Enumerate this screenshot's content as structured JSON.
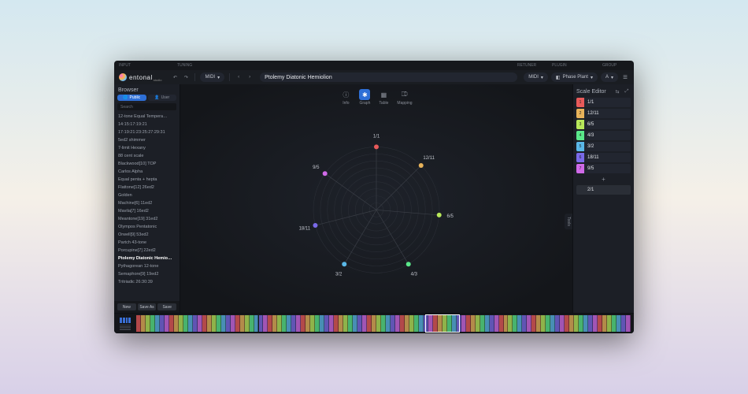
{
  "app": {
    "name": "entonal",
    "sub": "studio"
  },
  "topbar": {
    "input": "INPUT",
    "tuning": "TUNING",
    "retuner": "RETUNER",
    "plugin": "PLUGIN",
    "group": "GROUP"
  },
  "header": {
    "input_tag": "MIDI",
    "tuning_name": "Ptolemy Diatonic Hemiolion",
    "retuner_tag": "MIDI",
    "plugin_tag": "Phase Plant",
    "group_tag": "A"
  },
  "browser": {
    "title": "Browser",
    "tab_public": "Public",
    "tab_user": "User",
    "search_placeholder": "Search",
    "items": [
      "12-tone Equal Tempera…",
      "14:15:17:19:21",
      "17:19:21:23:25:27:29:31",
      "5ed2 shimmer",
      "7-limit Hexany",
      "88 cent scale",
      "Blackwood[10] TOP",
      "Carlos Alpha",
      "Equal penta + hepta",
      "Flattone[12] 26ed2",
      "Golden",
      "Machine[6] 11ed2",
      "Mavila[7] 16ed2",
      "Meantone[19] 31ed2",
      "Olympos Pentatonic",
      "Orwell[9] 53ed2",
      "Partch 43-tone",
      "Porcupine[7] 22ed2",
      "Ptolemy Diatonic Hemio…",
      "Pythagorean 12-tone",
      "Semaphore[9] 19ed2",
      "Tritriadic 26:30:39"
    ],
    "selected_index": 18,
    "btn_new": "New",
    "btn_saveas": "Save As",
    "btn_save": "Save"
  },
  "views": {
    "tabs": [
      {
        "id": "info",
        "label": "Info",
        "glyph": "ⓘ"
      },
      {
        "id": "graph",
        "label": "Graph",
        "glyph": "✱"
      },
      {
        "id": "table",
        "label": "Table",
        "glyph": "▦"
      },
      {
        "id": "mapping",
        "label": "Mapping",
        "glyph": "⎄"
      }
    ],
    "active": 1,
    "tools_label": "Tools"
  },
  "scale_notes": {
    "title": "Scale Editor",
    "period": "2/1",
    "items": [
      {
        "idx": "1",
        "ratio": "1/1",
        "color": "#e85a5a"
      },
      {
        "idx": "2",
        "ratio": "12/11",
        "color": "#e8b35a"
      },
      {
        "idx": "3",
        "ratio": "6/5",
        "color": "#b8e85a"
      },
      {
        "idx": "4",
        "ratio": "4/3",
        "color": "#5ae88a"
      },
      {
        "idx": "5",
        "ratio": "3/2",
        "color": "#5ab8e8"
      },
      {
        "idx": "6",
        "ratio": "18/11",
        "color": "#7a6ae8"
      },
      {
        "idx": "7",
        "ratio": "9/5",
        "color": "#d06ae8"
      }
    ]
  },
  "chart_data": {
    "type": "polar-scatter",
    "title": "",
    "angle_unit": "cents",
    "period": 1200,
    "rings": 9,
    "points": [
      {
        "label": "1/1",
        "angle_cents": 0.0,
        "color": "#e85a5a"
      },
      {
        "label": "12/11",
        "angle_cents": 150.6,
        "color": "#e8b35a"
      },
      {
        "label": "6/5",
        "angle_cents": 315.6,
        "color": "#b8e85a"
      },
      {
        "label": "4/3",
        "angle_cents": 498.0,
        "color": "#5ae88a"
      },
      {
        "label": "3/2",
        "angle_cents": 702.0,
        "color": "#5ab8e8"
      },
      {
        "label": "18/11",
        "angle_cents": 852.6,
        "color": "#7a6ae8"
      },
      {
        "label": "9/5",
        "angle_cents": 1017.6,
        "color": "#d06ae8"
      }
    ]
  },
  "keyboard": {
    "active_start": 0.585,
    "active_end": 0.655
  }
}
